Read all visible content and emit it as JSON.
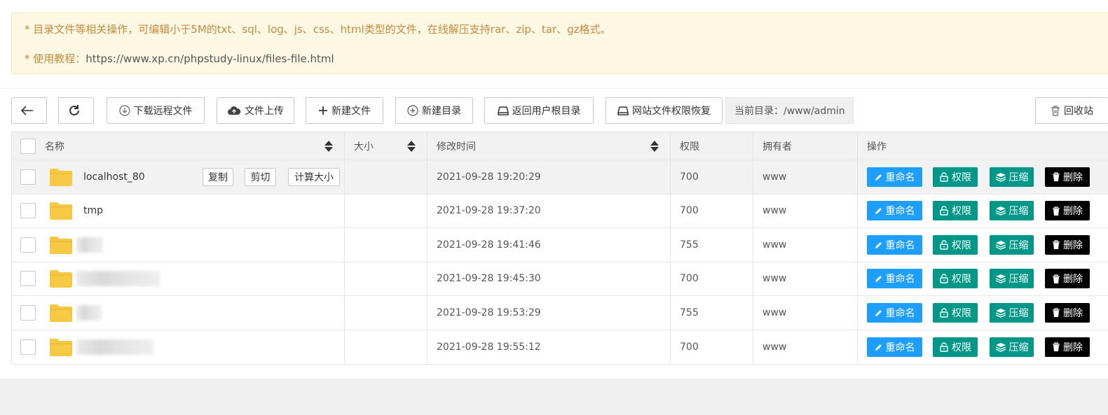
{
  "notice": {
    "line1": "* 目录文件等相关操作，可编辑小于5M的txt、sql、log、js、css、html类型的文件，在线解压支持rar、zip、tar、gz格式。",
    "line2_prefix": "* 使用教程：",
    "line2_url": "https://www.xp.cn/phpstudy-linux/files-file.html"
  },
  "toolbar": {
    "download_remote": "下载远程文件",
    "upload": "文件上传",
    "new_file": "新建文件",
    "new_dir": "新建目录",
    "home_dir": "返回用户根目录",
    "perm_restore": "网站文件权限恢复",
    "current_dir": "当前目录：/www/admin",
    "recycle": "回收站"
  },
  "table": {
    "headers": {
      "name": "名称",
      "size": "大小",
      "mtime": "修改时间",
      "perm": "权限",
      "owner": "拥有者",
      "actions": "操作"
    },
    "row_buttons": {
      "copy": "复制",
      "cut": "剪切",
      "calc_size": "计算大小"
    },
    "action_labels": {
      "rename": "重命名",
      "perm": "权限",
      "zip": "压缩",
      "delete": "删除"
    },
    "rows": [
      {
        "name": "localhost_80",
        "mtime": "2021-09-28 19:20:29",
        "perm": "700",
        "owner": "www"
      },
      {
        "name": "tmp",
        "mtime": "2021-09-28 19:37:20",
        "perm": "700",
        "owner": "www"
      },
      {
        "name": "",
        "mtime": "2021-09-28 19:41:46",
        "perm": "755",
        "owner": "www"
      },
      {
        "name": "",
        "mtime": "2021-09-28 19:45:30",
        "perm": "700",
        "owner": "www"
      },
      {
        "name": "",
        "mtime": "2021-09-28 19:53:29",
        "perm": "755",
        "owner": "www"
      },
      {
        "name": "",
        "mtime": "2021-09-28 19:55:12",
        "perm": "700",
        "owner": "www"
      }
    ]
  },
  "colors": {
    "rename": "#1e9fff",
    "perm": "#009688",
    "zip": "#009688",
    "delete": "#000000",
    "folder": "#f7c844",
    "notice_bg": "#fdf8e4",
    "notice_text": "#c68b3d"
  }
}
